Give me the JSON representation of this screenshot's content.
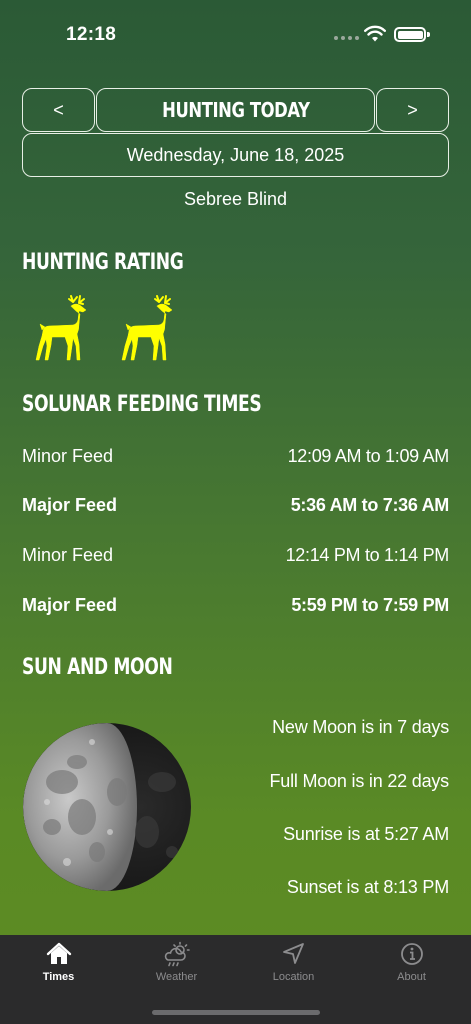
{
  "status": {
    "time": "12:18"
  },
  "header": {
    "prev_label": "<",
    "title": "HUNTING TODAY",
    "next_label": ">",
    "date": "Wednesday, June 18, 2025",
    "location": "Sebree Blind"
  },
  "rating": {
    "heading": "HUNTING RATING",
    "deer_count": 2,
    "deer_color": "#ffff00"
  },
  "solunar": {
    "heading": "SOLUNAR FEEDING TIMES",
    "rows": [
      {
        "label": "Minor Feed",
        "time": "12:09 AM to 1:09 AM",
        "major": false
      },
      {
        "label": "Major Feed",
        "time": "5:36 AM to 7:36 AM",
        "major": true
      },
      {
        "label": "Minor Feed",
        "time": "12:14 PM to 1:14 PM",
        "major": false
      },
      {
        "label": "Major Feed",
        "time": "5:59 PM to 7:59 PM",
        "major": true
      }
    ]
  },
  "sun_moon": {
    "heading": "SUN AND MOON",
    "moon_phase": "first quarter",
    "lines": [
      "New Moon is in 7 days",
      "Full Moon is in 22 days",
      "Sunrise is at 5:27 AM",
      "Sunset is at 8:13 PM"
    ]
  },
  "tabs": [
    {
      "label": "Times",
      "icon": "house-icon",
      "active": true
    },
    {
      "label": "Weather",
      "icon": "cloud-sun-icon",
      "active": false
    },
    {
      "label": "Location",
      "icon": "location-arrow-icon",
      "active": false
    },
    {
      "label": "About",
      "icon": "info-icon",
      "active": false
    }
  ],
  "colors": {
    "accent": "#ffff00",
    "tab_bar": "#2b2b2c",
    "tab_inactive": "#8c8c8e"
  }
}
